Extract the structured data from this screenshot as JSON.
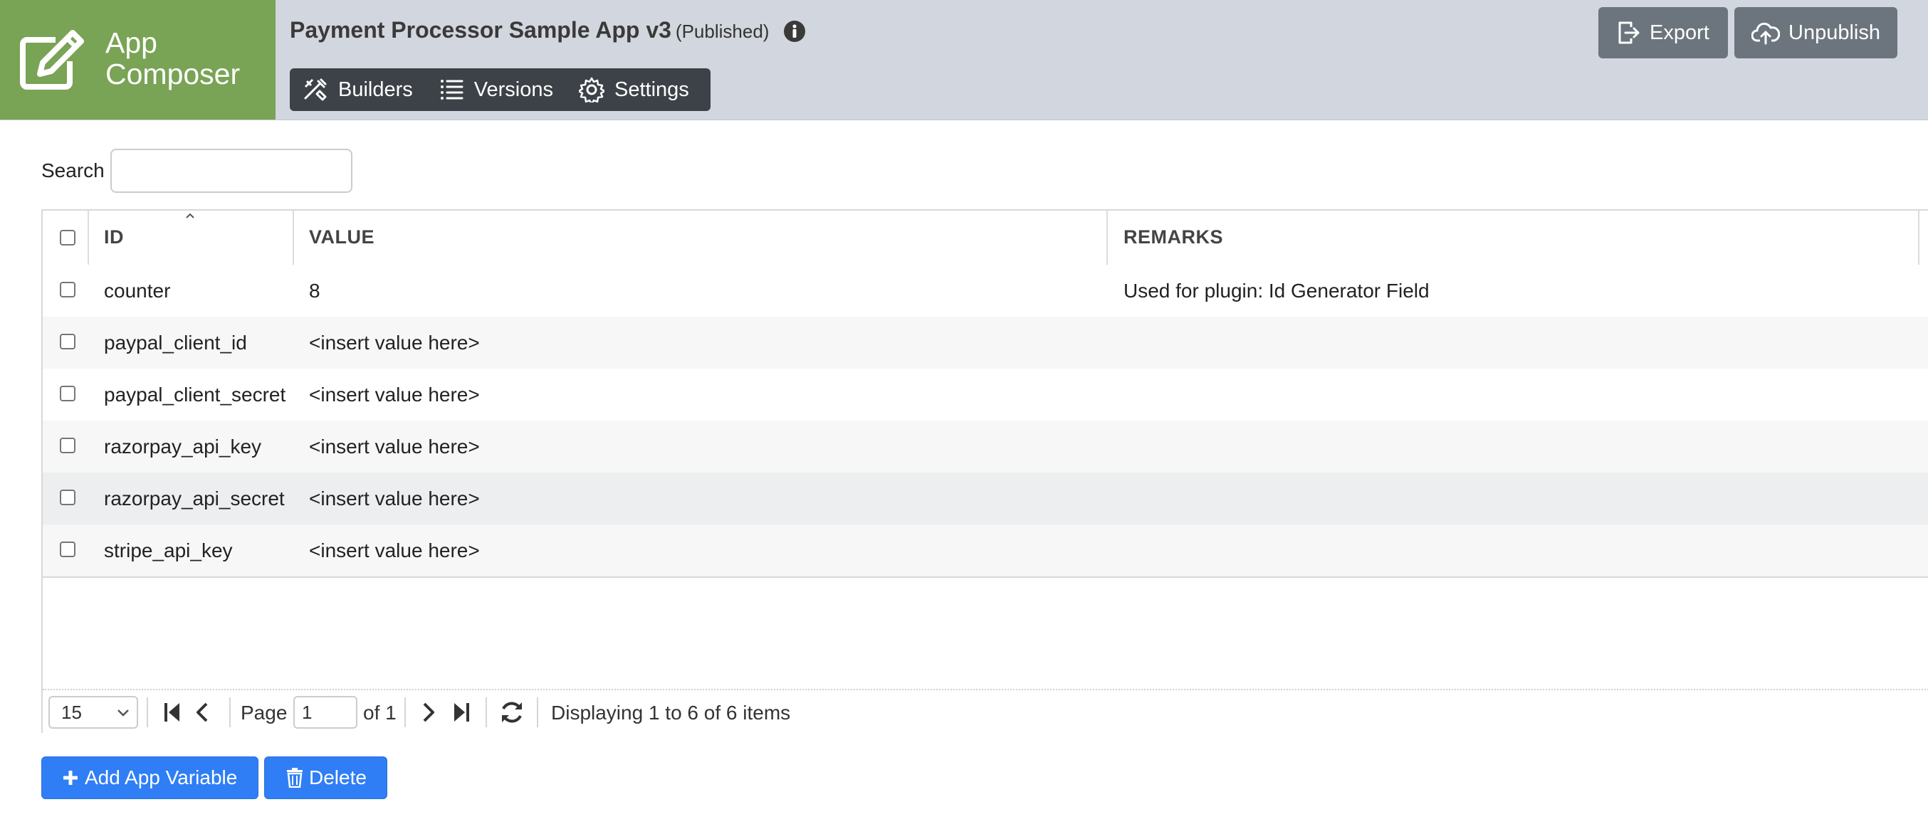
{
  "brand": {
    "name": "App\nComposer"
  },
  "app": {
    "title": "Payment Processor Sample App v3",
    "status": "(Published)"
  },
  "nav": {
    "items": [
      {
        "label": "Builders",
        "icon": "builders-icon"
      },
      {
        "label": "Versions",
        "icon": "list-icon"
      },
      {
        "label": "Settings",
        "icon": "gear-icon"
      }
    ]
  },
  "header_actions": {
    "export_label": "Export",
    "unpublish_label": "Unpublish"
  },
  "search": {
    "label": "Search",
    "value": "",
    "placeholder": ""
  },
  "table": {
    "columns": [
      "ID",
      "VALUE",
      "REMARKS"
    ],
    "sorted_column": "ID",
    "rows": [
      {
        "id": "counter",
        "value": "8",
        "remarks": "Used for plugin: Id Generator Field"
      },
      {
        "id": "paypal_client_id",
        "value": "<insert value here>",
        "remarks": ""
      },
      {
        "id": "paypal_client_secret",
        "value": "<insert value here>",
        "remarks": ""
      },
      {
        "id": "razorpay_api_key",
        "value": "<insert value here>",
        "remarks": ""
      },
      {
        "id": "razorpay_api_secret",
        "value": "<insert value here>",
        "remarks": ""
      },
      {
        "id": "stripe_api_key",
        "value": "<insert value here>",
        "remarks": ""
      }
    ]
  },
  "pager": {
    "page_size": "15",
    "page_label": "Page",
    "page_value": "1",
    "of_label": "of 1",
    "display_text": "Displaying 1 to 6 of 6 items"
  },
  "actions": {
    "add_label": "Add App Variable",
    "delete_label": "Delete"
  },
  "colors": {
    "brand_green": "#79a355",
    "header_bg": "#d2d6de",
    "nav_bg": "#3d4248",
    "primary": "#2f7ef5",
    "secondary": "#6c757d"
  }
}
